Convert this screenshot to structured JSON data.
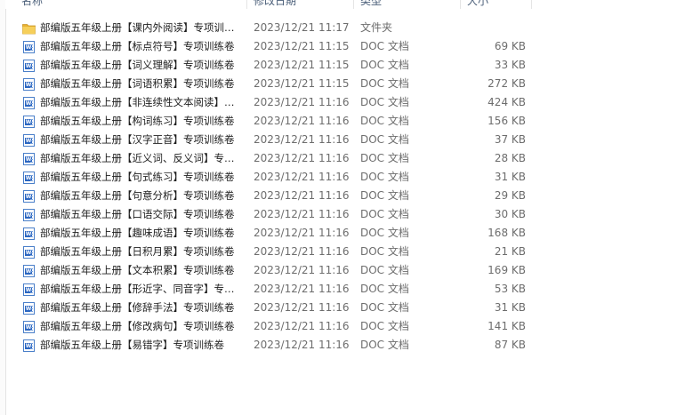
{
  "columns": {
    "name": "名称",
    "date": "修改日期",
    "type": "类型",
    "size": "大小"
  },
  "files": [
    {
      "name": "部编版五年级上册【课内外阅读】专项训练卷",
      "date": "2023/12/21 11:17",
      "type": "文件夹",
      "size": "",
      "icon": "folder-icon"
    },
    {
      "name": "部编版五年级上册【标点符号】专项训练卷",
      "date": "2023/12/21 11:15",
      "type": "DOC 文档",
      "size": "69 KB",
      "icon": "doc-icon"
    },
    {
      "name": "部编版五年级上册【词义理解】专项训练卷",
      "date": "2023/12/21 11:15",
      "type": "DOC 文档",
      "size": "33 KB",
      "icon": "doc-icon"
    },
    {
      "name": "部编版五年级上册【词语积累】专项训练卷",
      "date": "2023/12/21 11:15",
      "type": "DOC 文档",
      "size": "272 KB",
      "icon": "doc-icon"
    },
    {
      "name": "部编版五年级上册【非连续性文本阅读】专项训练卷",
      "date": "2023/12/21 11:16",
      "type": "DOC 文档",
      "size": "424 KB",
      "icon": "doc-icon"
    },
    {
      "name": "部编版五年级上册【构词练习】专项训练卷",
      "date": "2023/12/21 11:16",
      "type": "DOC 文档",
      "size": "156 KB",
      "icon": "doc-icon"
    },
    {
      "name": "部编版五年级上册【汉字正音】专项训练卷",
      "date": "2023/12/21 11:16",
      "type": "DOC 文档",
      "size": "37 KB",
      "icon": "doc-icon"
    },
    {
      "name": "部编版五年级上册【近义词、反义词】专项训练卷",
      "date": "2023/12/21 11:16",
      "type": "DOC 文档",
      "size": "28 KB",
      "icon": "doc-icon"
    },
    {
      "name": "部编版五年级上册【句式练习】专项训练卷",
      "date": "2023/12/21 11:16",
      "type": "DOC 文档",
      "size": "31 KB",
      "icon": "doc-icon"
    },
    {
      "name": "部编版五年级上册【句意分析】专项训练卷",
      "date": "2023/12/21 11:16",
      "type": "DOC 文档",
      "size": "29 KB",
      "icon": "doc-icon"
    },
    {
      "name": "部编版五年级上册【口语交际】专项训练卷",
      "date": "2023/12/21 11:16",
      "type": "DOC 文档",
      "size": "30 KB",
      "icon": "doc-icon"
    },
    {
      "name": "部编版五年级上册【趣味成语】专项训练卷",
      "date": "2023/12/21 11:16",
      "type": "DOC 文档",
      "size": "168 KB",
      "icon": "doc-icon"
    },
    {
      "name": "部编版五年级上册【日积月累】专项训练卷",
      "date": "2023/12/21 11:16",
      "type": "DOC 文档",
      "size": "21 KB",
      "icon": "doc-icon"
    },
    {
      "name": "部编版五年级上册【文本积累】专项训练卷",
      "date": "2023/12/21 11:16",
      "type": "DOC 文档",
      "size": "169 KB",
      "icon": "doc-icon"
    },
    {
      "name": "部编版五年级上册【形近字、同音字】专项训练卷",
      "date": "2023/12/21 11:16",
      "type": "DOC 文档",
      "size": "53 KB",
      "icon": "doc-icon"
    },
    {
      "name": "部编版五年级上册【修辞手法】专项训练卷",
      "date": "2023/12/21 11:16",
      "type": "DOC 文档",
      "size": "31 KB",
      "icon": "doc-icon"
    },
    {
      "name": "部编版五年级上册【修改病句】专项训练卷",
      "date": "2023/12/21 11:16",
      "type": "DOC 文档",
      "size": "141 KB",
      "icon": "doc-icon"
    },
    {
      "name": "部编版五年级上册【易错字】专项训练卷",
      "date": "2023/12/21 11:16",
      "type": "DOC 文档",
      "size": "87 KB",
      "icon": "doc-icon"
    }
  ],
  "colors": {
    "folder": "#f3c446",
    "doc": "#2b66c1",
    "muted_text": "#6d6d6d"
  }
}
